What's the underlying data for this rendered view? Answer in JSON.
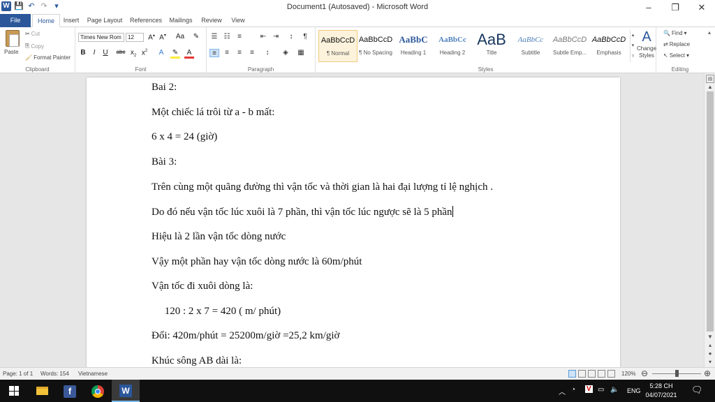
{
  "window": {
    "title": "Document1 (Autosaved) - Microsoft Word",
    "minimize": "–",
    "restore": "❐",
    "close": "✕"
  },
  "qat": {
    "logo": "W",
    "save": "💾",
    "undo": "↶",
    "redo": "↷",
    "more": "▾"
  },
  "tabs": [
    "File",
    "Home",
    "Insert",
    "Page Layout",
    "References",
    "Mailings",
    "Review",
    "View"
  ],
  "ribbon": {
    "clipboard": {
      "paste": "Paste",
      "cut": "Cut",
      "copy": "Copy",
      "format_painter": "Format Painter",
      "label": "Clipboard"
    },
    "font": {
      "name": "Times New Rom",
      "size": "12",
      "label": "Font"
    },
    "paragraph": {
      "label": "Paragraph"
    },
    "styles": {
      "label": "Styles",
      "items": [
        {
          "sample": "AaBbCcD",
          "name": "¶ Normal"
        },
        {
          "sample": "AaBbCcD",
          "name": "¶ No Spacing"
        },
        {
          "sample": "AaBbC",
          "name": "Heading 1"
        },
        {
          "sample": "AaBbCc",
          "name": "Heading 2"
        },
        {
          "sample": "AaB",
          "name": "Title"
        },
        {
          "sample": "AaBbCc",
          "name": "Subtitle"
        },
        {
          "sample": "AaBbCcD",
          "name": "Subtle Emp..."
        },
        {
          "sample": "AaBbCcD",
          "name": "Emphasis"
        }
      ],
      "change_styles": "Change Styles"
    },
    "editing": {
      "find": "Find",
      "replace": "Replace",
      "select": "Select",
      "label": "Editing"
    }
  },
  "document": {
    "lines": [
      "Bai 2:",
      "Một chiếc lá trôi từ a - b mất:",
      " 6 x 4 = 24 (giờ)",
      "Bài 3:",
      "Trên cùng một quãng đường thì vận tốc và thời gian là hai đại lượng tỉ lệ nghịch .",
      "Do đó nếu vận tốc lúc xuôi là 7 phần, thì vận tốc lúc ngược sẽ là 5 phần",
      "Hiệu là 2 lần vận tốc dòng nước",
      "Vậy một phần hay vận tốc dòng nước là 60m/phút",
      "Vận tốc đi xuôi dòng là:",
      "     120 : 2 x 7 = 420 ( m/ phút)",
      "Đổi: 420m/phút = 25200m/giờ =25,2 km/giờ",
      "Khúc sông AB dài là:"
    ]
  },
  "status": {
    "page": "Page: 1 of 1",
    "words": "Words: 154",
    "language": "Vietnamese",
    "zoom": "120%"
  },
  "taskbar": {
    "lang": "ENG",
    "time": "5:28 CH",
    "date": "04/07/2021"
  }
}
